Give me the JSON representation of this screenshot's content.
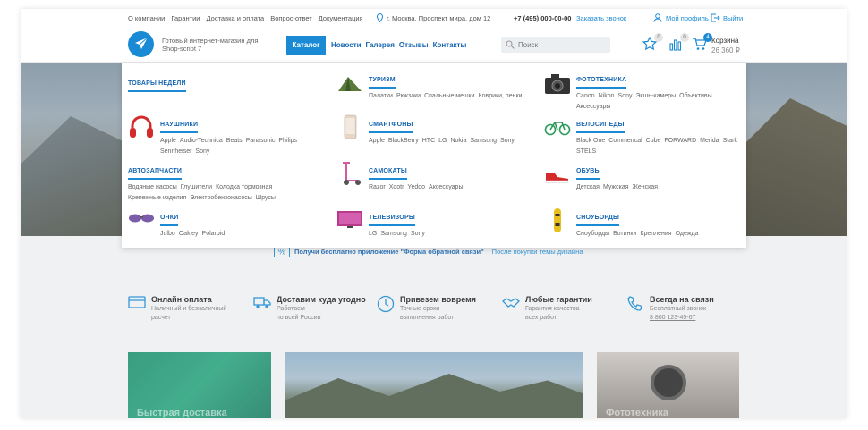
{
  "topbar": {
    "links": [
      "О компании",
      "Гарантии",
      "Доставка и оплата",
      "Вопрос-ответ",
      "Документация"
    ],
    "address": "г. Москва, Проспект мира, дом 12",
    "phone": "+7 (495) 000-00-00",
    "callback": "Заказать звонок",
    "profile": "Мой профиль",
    "logout": "Выйти"
  },
  "header": {
    "tagline": "Готовый интернет-магазин для Shop-script 7",
    "catalog_button": "Каталог",
    "nav": [
      "Новости",
      "Галерея",
      "Отзывы",
      "Контакты"
    ],
    "search_placeholder": "Поиск",
    "favorites_count": "0",
    "compare_count": "0",
    "cart_count": "4",
    "cart_label": "Корзина",
    "cart_total": "26 360 ₽"
  },
  "catalog": [
    {
      "title": "ТОВАРЫ НЕДЕЛИ",
      "items": [],
      "icon": "none"
    },
    {
      "title": "ТУРИЗМ",
      "items": [
        "Палатки",
        "Рюкзаки",
        "Спальные мешки",
        "Коврики, пенки"
      ],
      "icon": "tent-icon"
    },
    {
      "title": "ФОТОТЕХНИКА",
      "items": [
        "Canon",
        "Nikon",
        "Sony",
        "Экшн-камеры",
        "Объективы",
        "Аксессуары"
      ],
      "icon": "camera-icon"
    },
    {
      "title": "НАУШНИКИ",
      "items": [
        "Apple",
        "Audio-Technica",
        "Beats",
        "Panasonic",
        "Philips",
        "Sennheiser",
        "Sony"
      ],
      "icon": "headphones-icon"
    },
    {
      "title": "СМАРТФОНЫ",
      "items": [
        "Apple",
        "BlackBerry",
        "HTC",
        "LG",
        "Nokia",
        "Samsung",
        "Sony"
      ],
      "icon": "smartphone-icon"
    },
    {
      "title": "ВЕЛОСИПЕДЫ",
      "items": [
        "Black One",
        "Commencal",
        "Cube",
        "FORWARD",
        "Merida",
        "Stark",
        "STELS"
      ],
      "icon": "bicycle-icon"
    },
    {
      "title": "АВТОЗАПЧАСТИ",
      "items": [
        "Водяные насосы",
        "Глушители",
        "Колодка тормозная",
        "Крепежные изделия",
        "Электробензонасосы",
        "Шрусы"
      ],
      "icon": "none"
    },
    {
      "title": "САМОКАТЫ",
      "items": [
        "Razor",
        "Xootr",
        "Yedoo",
        "Аксессуары"
      ],
      "icon": "scooter-icon"
    },
    {
      "title": "ОБУВЬ",
      "items": [
        "Детская",
        "Мужская",
        "Женская"
      ],
      "icon": "shoe-icon"
    },
    {
      "title": "ОЧКИ",
      "items": [
        "Julbo",
        "Oakley",
        "Polaroid"
      ],
      "icon": "glasses-icon"
    },
    {
      "title": "ТЕЛЕВИЗОРЫ",
      "items": [
        "LG",
        "Samsung",
        "Sony"
      ],
      "icon": "tv-icon"
    },
    {
      "title": "СНОУБОРДЫ",
      "items": [
        "Сноуборды",
        "Ботинки",
        "Крепления",
        "Одежда"
      ],
      "icon": "snowboard-icon"
    }
  ],
  "promo": {
    "strong": "Получи бесплатно приложение \"Форма обратной связи\"",
    "light": "После покупки темы дизайна"
  },
  "features": [
    {
      "title": "Онлайн оплата",
      "sub1": "Наличный и безналичный",
      "sub2": "расчет",
      "icon": "card-icon"
    },
    {
      "title": "Доставим куда угодно",
      "sub1": "Работаем",
      "sub2": "по всей России",
      "icon": "truck-icon"
    },
    {
      "title": "Привезем вовремя",
      "sub1": "Точные сроки",
      "sub2": "выполнения работ",
      "icon": "clock-icon"
    },
    {
      "title": "Любые гарантии",
      "sub1": "Гарантия качества",
      "sub2": "всех работ",
      "icon": "handshake-icon"
    },
    {
      "title": "Всегда на связи",
      "sub1": "Бесплатный звонок",
      "sub2": "8 800 123-45-67",
      "icon": "phone-icon"
    }
  ],
  "cards": [
    {
      "label": "Быстрая доставка"
    },
    {
      "label": ""
    },
    {
      "label": "Фототехника"
    }
  ],
  "colors": {
    "accent": "#1a8ad4",
    "nav": "#1565b0"
  }
}
